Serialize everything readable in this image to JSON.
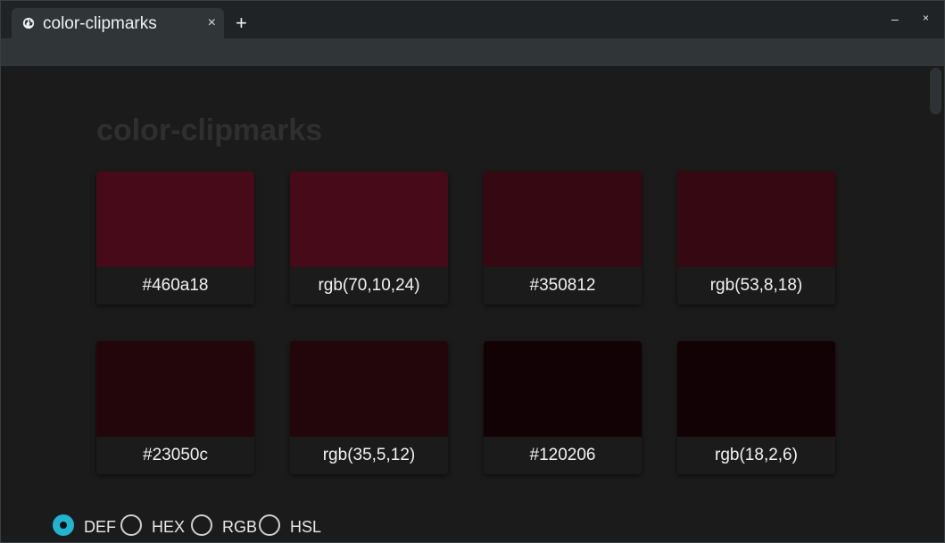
{
  "window": {
    "tab_title": "color-clipmarks",
    "tab_close": "×",
    "new_tab": "+",
    "minimize": "–",
    "close": "×"
  },
  "page": {
    "title": "color-clipmarks"
  },
  "swatches": [
    {
      "label": "#460a18",
      "color": "#460a18"
    },
    {
      "label": "rgb(70,10,24)",
      "color": "#460a18"
    },
    {
      "label": "#350812",
      "color": "#350812"
    },
    {
      "label": "rgb(53,8,18)",
      "color": "#350812"
    },
    {
      "label": "#23050c",
      "color": "#23050c"
    },
    {
      "label": "rgb(35,5,12)",
      "color": "#23050c"
    },
    {
      "label": "#120206",
      "color": "#120206"
    },
    {
      "label": "rgb(18,2,6)",
      "color": "#120206"
    }
  ],
  "format_options": [
    {
      "label": "DEF",
      "selected": true
    },
    {
      "label": "HEX",
      "selected": false
    },
    {
      "label": "RGB",
      "selected": false
    },
    {
      "label": "HSL",
      "selected": false
    }
  ],
  "colors": {
    "accent": "#22b3cf",
    "tab_background": "#303537",
    "titlebar_background": "#202325",
    "content_background": "#1b1b1b"
  }
}
